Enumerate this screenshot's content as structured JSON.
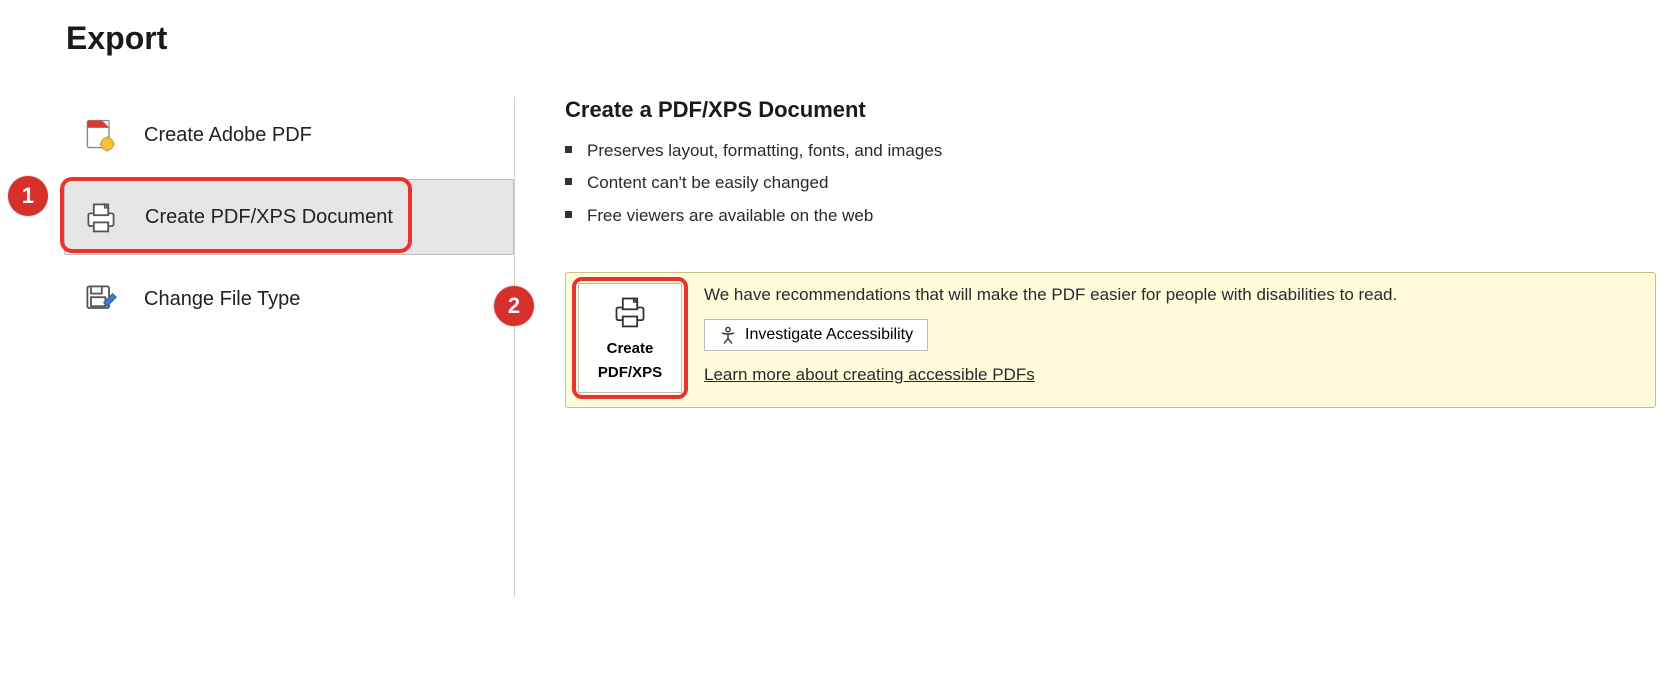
{
  "title": "Export",
  "left": {
    "options": [
      {
        "label": "Create Adobe PDF",
        "selected": false
      },
      {
        "label": "Create PDF/XPS Document",
        "selected": true
      },
      {
        "label": "Change File Type",
        "selected": false
      }
    ]
  },
  "right": {
    "heading": "Create a PDF/XPS Document",
    "bullets": [
      "Preserves layout, formatting, fonts, and images",
      "Content can't be easily changed",
      "Free viewers are available on the web"
    ],
    "panel": {
      "button_line1": "Create",
      "button_line2": "PDF/XPS",
      "text": "We have recommendations that will make the PDF easier for people with disabilities to read.",
      "investigate_label": "Investigate Accessibility",
      "learn_more": "Learn more about creating accessible PDFs"
    }
  },
  "annotations": {
    "step1": "1",
    "step2": "2"
  }
}
